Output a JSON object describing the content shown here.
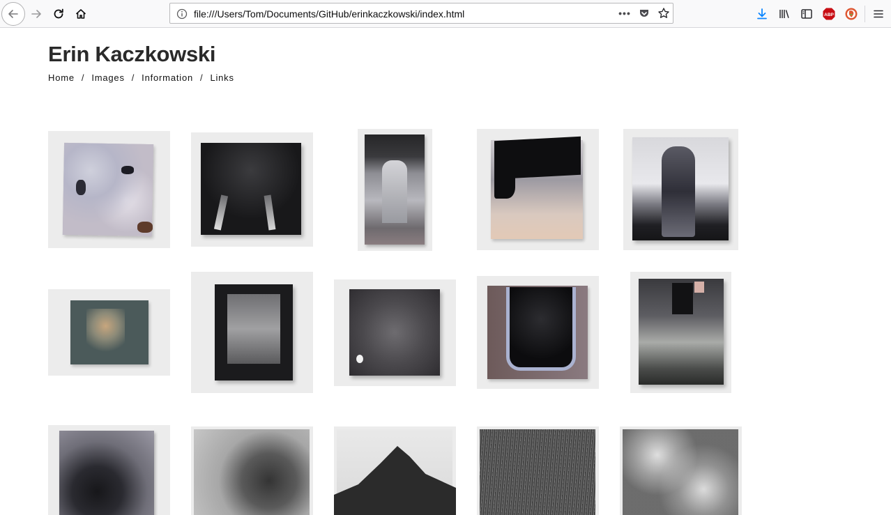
{
  "browser": {
    "url": "file:///Users/Tom/Documents/GitHub/erinkaczkowski/index.html",
    "icons": [
      "back-arrow-icon",
      "forward-arrow-icon",
      "reload-icon",
      "home-icon",
      "info-icon",
      "more-dots-icon",
      "pocket-icon",
      "bookmark-star-icon",
      "download-icon",
      "library-icon",
      "sidebar-icon",
      "adblock-icon",
      "duckduckgo-icon",
      "menu-icon"
    ],
    "abp_label": "ABP",
    "dots": "•••"
  },
  "site": {
    "title": "Erin Kaczkowski",
    "nav": [
      "Home",
      "Images",
      "Information",
      "Links"
    ],
    "separator": "/"
  },
  "gallery": {
    "count": 15,
    "columns": 5
  },
  "colors": {
    "accent_download": "#0a84ff",
    "adblock_red": "#c80e14",
    "thumb_bg": "#ececec"
  }
}
